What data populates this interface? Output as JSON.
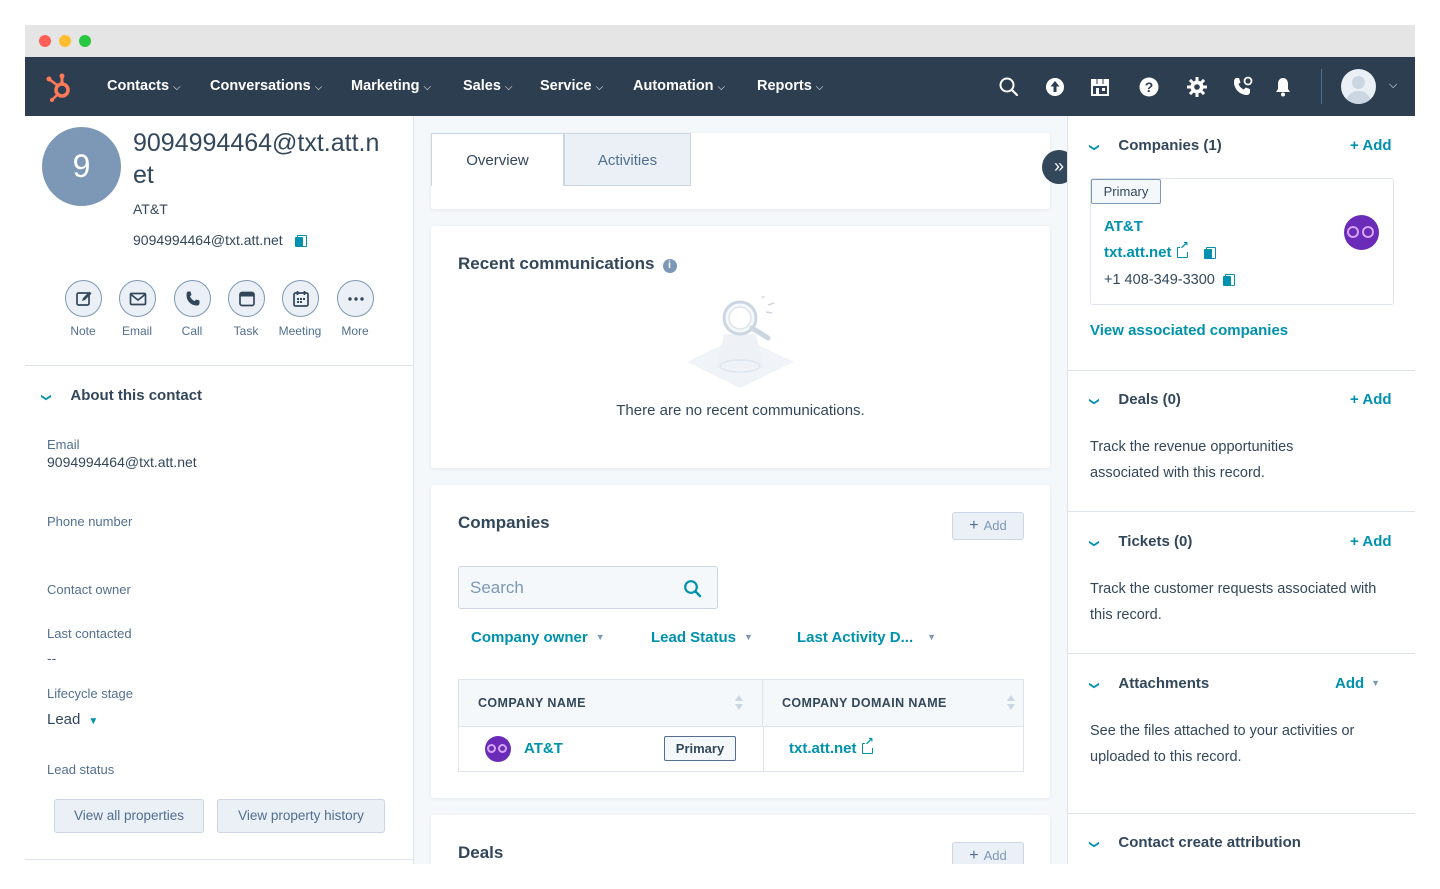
{
  "nav": {
    "items": [
      {
        "label": "Contacts"
      },
      {
        "label": "Conversations"
      },
      {
        "label": "Marketing"
      },
      {
        "label": "Sales"
      },
      {
        "label": "Service"
      },
      {
        "label": "Automation"
      },
      {
        "label": "Reports"
      }
    ],
    "icons": [
      "search-icon",
      "upgrade-icon",
      "marketplace-icon",
      "help-icon",
      "settings-icon",
      "calling-icon",
      "notifications-icon"
    ]
  },
  "contact": {
    "initial": "9",
    "name": "9094994464@txt.att.net",
    "company": "AT&T",
    "email": "9094994464@txt.att.net"
  },
  "actions": [
    {
      "label": "Note",
      "icon": "note-icon"
    },
    {
      "label": "Email",
      "icon": "email-icon"
    },
    {
      "label": "Call",
      "icon": "call-icon"
    },
    {
      "label": "Task",
      "icon": "task-icon"
    },
    {
      "label": "Meeting",
      "icon": "meeting-icon"
    },
    {
      "label": "More",
      "icon": "more-icon"
    }
  ],
  "about": {
    "title": "About this contact",
    "properties": {
      "email_label": "Email",
      "email_value": "9094994464@txt.att.net",
      "phone_label": "Phone number",
      "owner_label": "Contact owner",
      "last_contacted_label": "Last contacted",
      "last_contacted_value": "--",
      "lifecycle_label": "Lifecycle stage",
      "lifecycle_value": "Lead",
      "lead_status_label": "Lead status"
    },
    "view_all_label": "View all properties",
    "view_history_label": "View property history"
  },
  "tabs": [
    {
      "label": "Overview",
      "active": true
    },
    {
      "label": "Activities",
      "active": false
    }
  ],
  "recent_comms": {
    "title": "Recent communications",
    "empty_text": "There are no recent communications."
  },
  "companies_card": {
    "title": "Companies",
    "add_label": "Add",
    "search_placeholder": "Search",
    "filters": [
      {
        "label": "Company owner"
      },
      {
        "label": "Lead Status"
      },
      {
        "label": "Last Activity D..."
      }
    ],
    "columns": [
      "COMPANY NAME",
      "COMPANY DOMAIN NAME"
    ],
    "rows": [
      {
        "name": "AT&T",
        "badge": "Primary",
        "domain": "txt.att.net"
      }
    ]
  },
  "deals_card": {
    "title": "Deals",
    "add_label": "Add"
  },
  "sidebar": {
    "companies": {
      "title": "Companies (1)",
      "add_label": "+ Add",
      "badge": "Primary",
      "company_name": "AT&T",
      "domain": "txt.att.net",
      "phone": "+1 408-349-3300",
      "view_link": "View associated companies"
    },
    "deals": {
      "title": "Deals (0)",
      "add_label": "+ Add",
      "description": "Track the revenue opportunities associated with this record."
    },
    "tickets": {
      "title": "Tickets (0)",
      "add_label": "+ Add",
      "description": "Track the customer requests associated with this record."
    },
    "attachments": {
      "title": "Attachments",
      "add_label": "Add",
      "description": "See the files attached to your activities or uploaded to this record."
    },
    "attribution": {
      "title": "Contact create attribution"
    }
  },
  "colors": {
    "nav_bg": "#2d3e50",
    "accent": "#0091ae",
    "brand_orange": "#ff7a59",
    "avatar_bg": "#7c98b6",
    "text": "#33475b"
  }
}
